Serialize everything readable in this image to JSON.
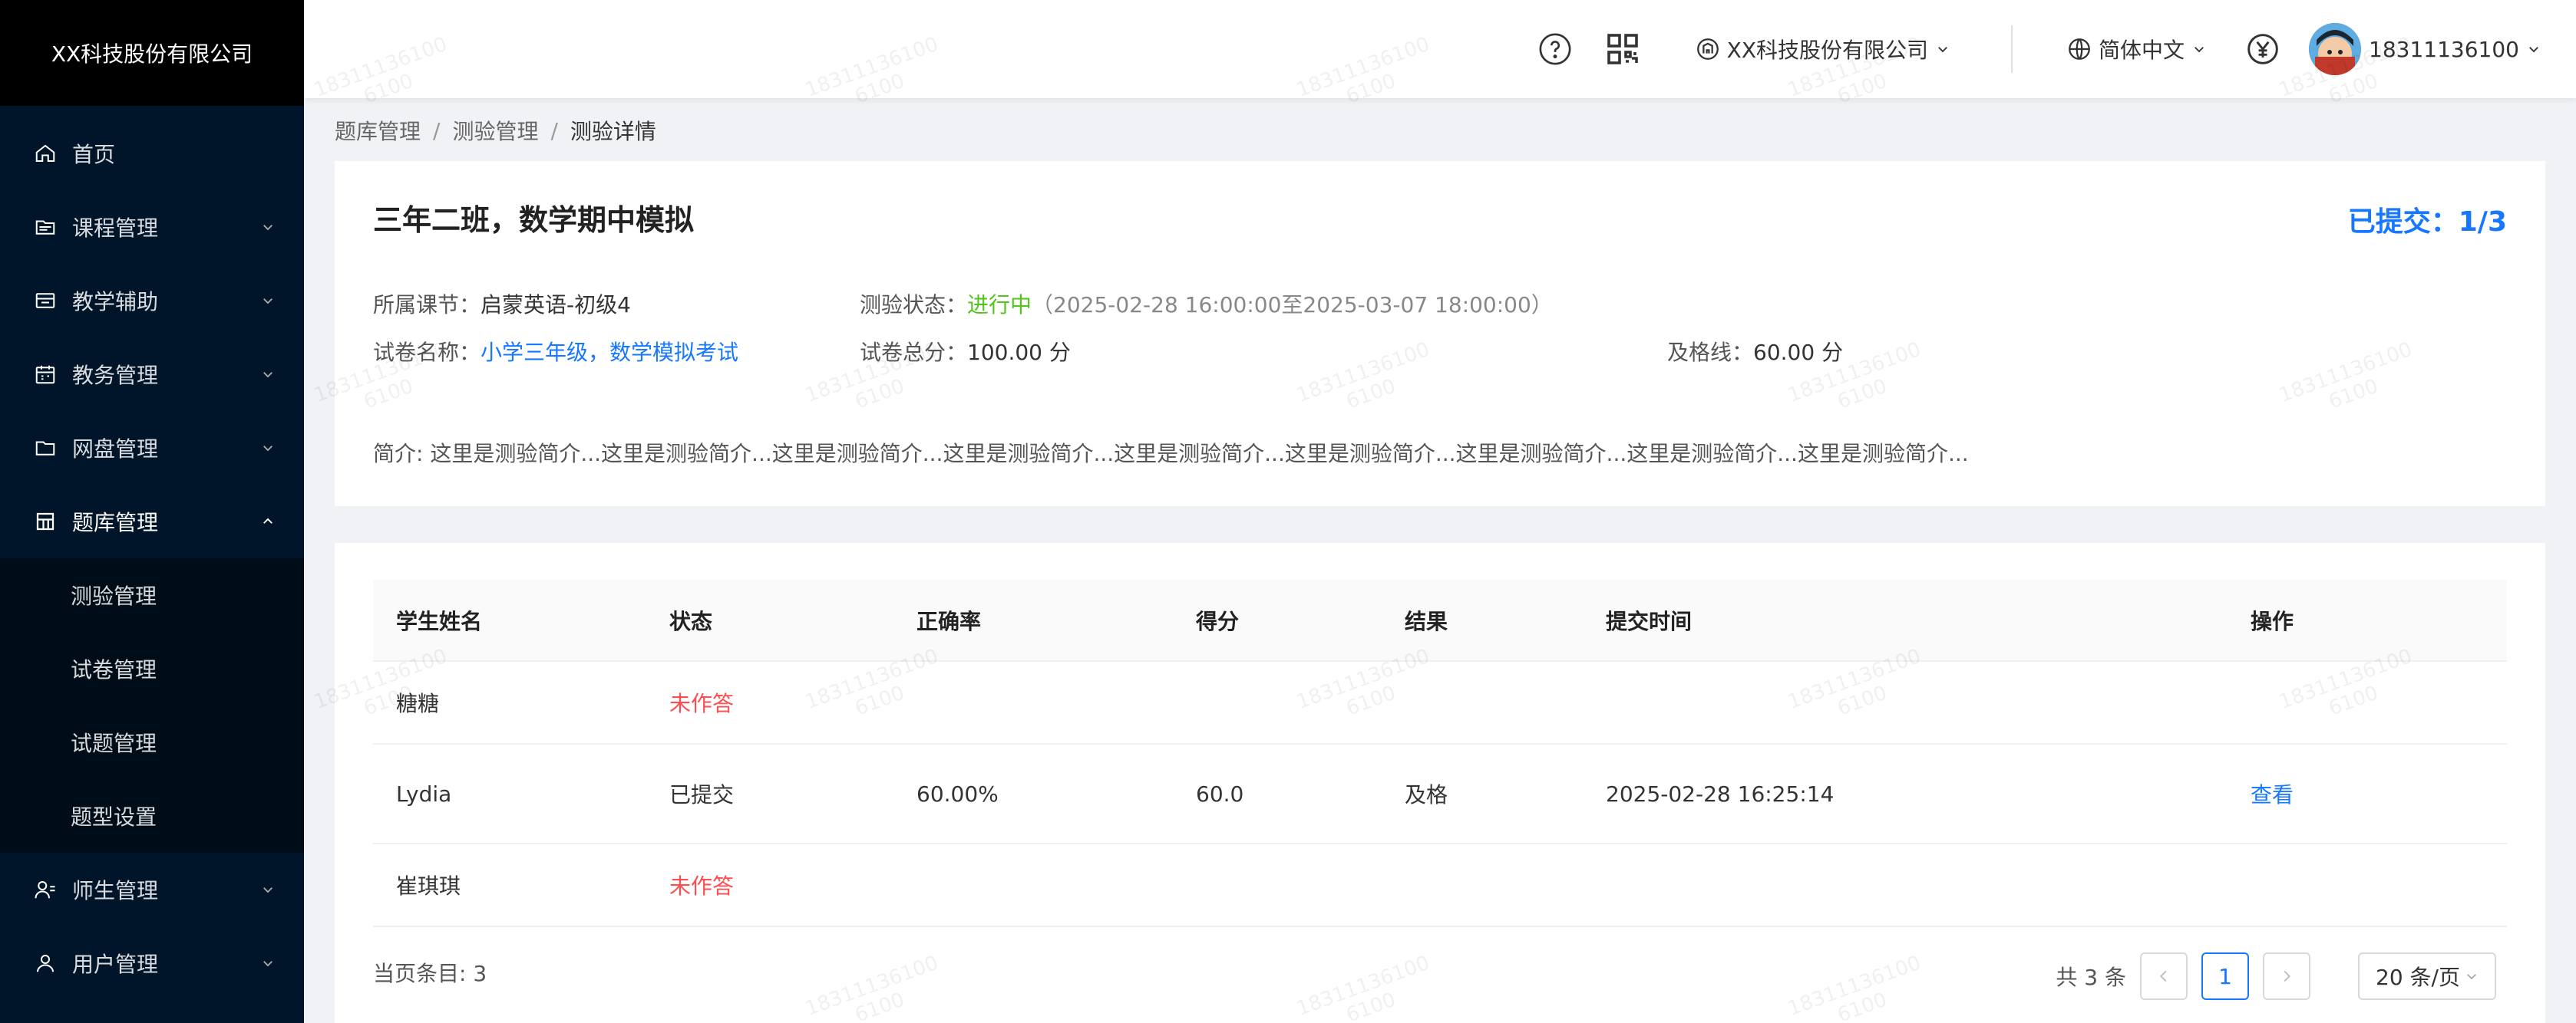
{
  "sidebar": {
    "company": "XX科技股份有限公司",
    "items": [
      {
        "label": "首页",
        "icon": "home-icon"
      },
      {
        "label": "课程管理",
        "icon": "course-icon"
      },
      {
        "label": "教学辅助",
        "icon": "teaching-icon"
      },
      {
        "label": "教务管理",
        "icon": "calendar-icon"
      },
      {
        "label": "网盘管理",
        "icon": "folder-icon"
      },
      {
        "label": "题库管理",
        "icon": "grid-icon"
      }
    ],
    "sub_items": [
      "测验管理",
      "试卷管理",
      "试题管理",
      "题型设置"
    ],
    "bottom_items": [
      {
        "label": "师生管理",
        "icon": "users-icon"
      },
      {
        "label": "用户管理",
        "icon": "user-icon"
      }
    ]
  },
  "header": {
    "org": "XX科技股份有限公司",
    "language": "简体中文",
    "phone": "18311136100"
  },
  "breadcrumb": [
    "题库管理",
    "测验管理",
    "测验详情"
  ],
  "quiz": {
    "title": "三年二班，数学期中模拟",
    "submitted": "已提交：1/3",
    "lesson_label": "所属课节：",
    "lesson": "启蒙英语-初级4",
    "status_label": "测验状态：",
    "status": "进行中",
    "period": "（2025-02-28 16:00:00至2025-03-07 18:00:00）",
    "paper_label": "试卷名称：",
    "paper": "小学三年级，数学模拟考试",
    "total_label": "试卷总分：",
    "total": "100.00 分",
    "pass_label": "及格线：",
    "pass": "60.00 分",
    "intro": "简介: 这里是测验简介...这里是测验简介...这里是测验简介...这里是测验简介...这里是测验简介...这里是测验简介...这里是测验简介...这里是测验简介...这里是测验简介..."
  },
  "table": {
    "headers": [
      "学生姓名",
      "状态",
      "正确率",
      "得分",
      "结果",
      "提交时间",
      "操作"
    ],
    "rows": [
      {
        "name": "糖糖",
        "status": "未作答",
        "accuracy": "",
        "score": "",
        "result": "",
        "time": "",
        "action": ""
      },
      {
        "name": "Lydia",
        "status": "已提交",
        "accuracy": "60.00%",
        "score": "60.0",
        "result": "及格",
        "time": "2025-02-28 16:25:14",
        "action": "查看"
      },
      {
        "name": "崔琪琪",
        "status": "未作答",
        "accuracy": "",
        "score": "",
        "result": "",
        "time": "",
        "action": ""
      }
    ]
  },
  "pagination": {
    "current_count": "当页条目: 3",
    "total": "共 3 条",
    "page": "1",
    "page_size": "20 条/页"
  },
  "watermark": {
    "line1": "18311136100",
    "line2": "6100"
  },
  "colors": {
    "sidebar": "#001529",
    "primary": "#1677ff",
    "green": "#52c41a",
    "red": "#ff4d4f"
  }
}
